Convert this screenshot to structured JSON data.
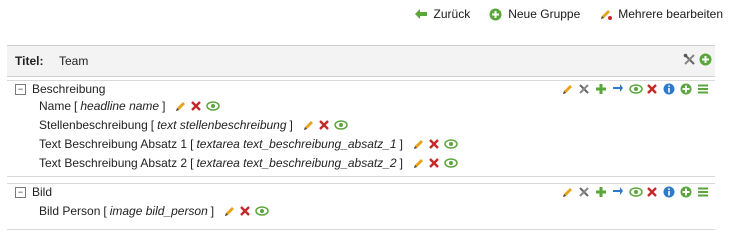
{
  "toolbar": {
    "back_label": "Zurück",
    "new_group_label": "Neue Gruppe",
    "edit_multiple_label": "Mehrere bearbeiten"
  },
  "header": {
    "title_label": "Titel:",
    "title_value": "Team"
  },
  "sections": [
    {
      "label": "Beschreibung",
      "fields": [
        {
          "name": "Name",
          "type": "headline name"
        },
        {
          "name": "Stellenbeschreibung",
          "type": "text stellenbeschreibung"
        },
        {
          "name": "Text Beschreibung Absatz 1",
          "type": "textarea text_beschreibung_absatz_1"
        },
        {
          "name": "Text Beschreibung Absatz 2",
          "type": "textarea text_beschreibung_absatz_2"
        }
      ]
    },
    {
      "label": "Bild",
      "fields": [
        {
          "name": "Bild Person",
          "type": "image bild_person"
        }
      ]
    }
  ],
  "colors": {
    "green": "#5aa63a",
    "red": "#c62828",
    "blue": "#2f79c9",
    "pencil": "#e8a21a",
    "header_bg": "#f3f3f3"
  },
  "punctuation": {
    "open": "[",
    "close": "]"
  }
}
